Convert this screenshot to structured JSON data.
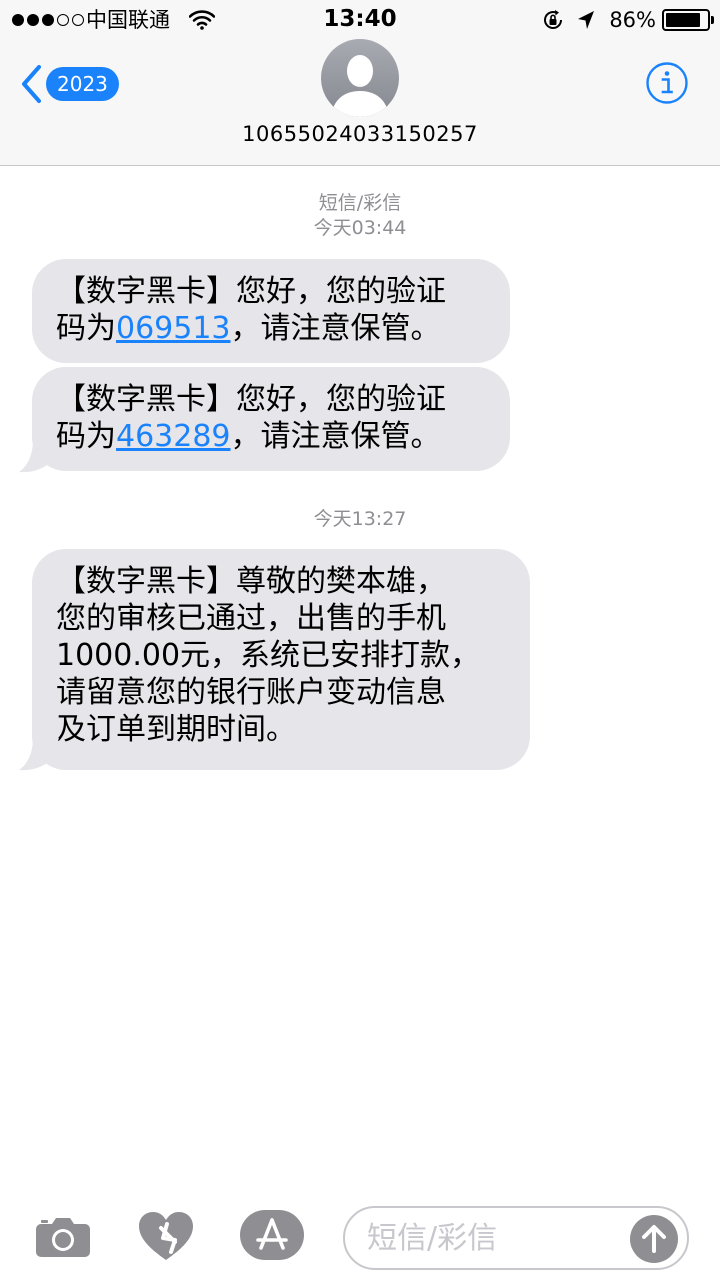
{
  "status_bar": {
    "carrier": "中国联通",
    "time": "13:40",
    "battery_percent": "86%",
    "battery_level": 0.86,
    "signal_bars_filled": 3,
    "signal_bars_total": 5
  },
  "header": {
    "back_badge": "2023",
    "contact_number": "10655024033150257",
    "avatar_icon": "person-silhouette-icon",
    "info_icon": "info-icon"
  },
  "thread": {
    "group1": {
      "channel_label": "短信/彩信",
      "timestamp": "今天03:44"
    },
    "msg1": {
      "prefix_line1": "【数字黑卡】您好，您的验证",
      "prefix_line2": "码为",
      "code": "069513",
      "suffix": "，请注意保管。"
    },
    "msg2": {
      "prefix_line1": "【数字黑卡】您好，您的验证",
      "prefix_line2": "码为",
      "code": "463289",
      "suffix": "，请注意保管。"
    },
    "group2": {
      "timestamp": "今天13:27"
    },
    "msg3": {
      "line1": "【数字黑卡】尊敬的樊本雄，",
      "line2": "您的审核已通过，出售的手机",
      "line3": "1000.00元，系统已安排打款，",
      "line4": "请留意您的银行账户变动信息",
      "line5": "及订单到期时间。"
    }
  },
  "input_bar": {
    "placeholder": "短信/彩信",
    "camera_icon": "camera-icon",
    "digital_touch_icon": "digital-touch-heart-icon",
    "app_store_icon": "app-store-icon",
    "send_icon": "send-arrow-up-icon"
  },
  "colors": {
    "accent": "#1a82fb",
    "bubble_incoming": "#e5e5ea",
    "meta_text": "#8e8e93"
  }
}
